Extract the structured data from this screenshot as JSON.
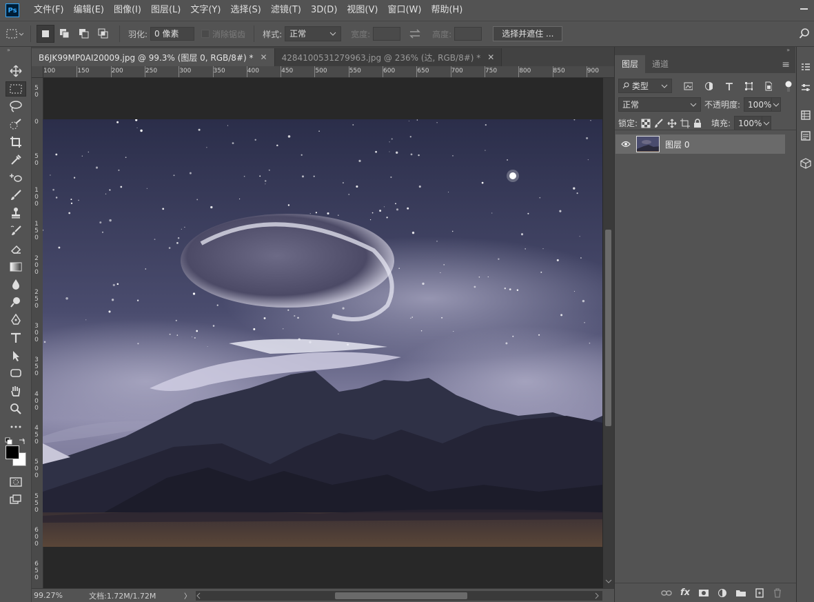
{
  "app": {
    "logo": "Ps"
  },
  "menu": [
    "文件(F)",
    "编辑(E)",
    "图像(I)",
    "图层(L)",
    "文字(Y)",
    "选择(S)",
    "滤镜(T)",
    "3D(D)",
    "视图(V)",
    "窗口(W)",
    "帮助(H)"
  ],
  "options": {
    "feather_label": "羽化:",
    "feather_value": "0 像素",
    "antialias_label": "消除锯齿",
    "style_label": "样式:",
    "style_value": "正常",
    "width_label": "宽度:",
    "height_label": "高度:",
    "select_mask_button": "选择并遮住 ..."
  },
  "tabs": [
    {
      "label": "B6JK99MP0AI20009.jpg @ 99.3% (图层 0, RGB/8#) *",
      "active": true
    },
    {
      "label": "4284100531279963.jpg @ 236% (达, RGB/8#) *",
      "active": false
    }
  ],
  "ruler": {
    "top": [
      "100",
      "150",
      "200",
      "250",
      "300",
      "350",
      "400",
      "450",
      "500",
      "550",
      "600",
      "650",
      "700",
      "750",
      "800",
      "850",
      "900"
    ],
    "left": [
      "5\n0",
      "0",
      "5\n0",
      "1\n0\n0",
      "1\n5\n0",
      "2\n0\n0",
      "2\n5\n0",
      "3\n0\n0",
      "3\n5\n0",
      "4\n0\n0",
      "4\n5\n0",
      "5\n0\n0",
      "5\n5\n0",
      "6\n0\n0",
      "6\n5\n0"
    ]
  },
  "status": {
    "zoom": "99.27%",
    "doc": "文档:1.72M/1.72M",
    "arrow": "〉"
  },
  "panel": {
    "tabs": [
      "图层",
      "通道"
    ],
    "kind_label": "类型",
    "blend_mode": "正常",
    "opacity_label": "不透明度:",
    "opacity_value": "100%",
    "lock_label": "锁定:",
    "fill_label": "填充:",
    "fill_value": "100%",
    "layer_name": "图层 0"
  },
  "icons": {
    "move": "move-icon",
    "marquee": "rect-marquee-icon",
    "lasso": "lasso-icon",
    "quick_select": "quick-select-icon",
    "crop": "crop-icon",
    "eyedropper": "eyedropper-icon",
    "healing": "healing-brush-icon",
    "brush": "brush-icon",
    "stamp": "clone-stamp-icon",
    "history_brush": "history-brush-icon",
    "eraser": "eraser-icon",
    "gradient": "gradient-icon",
    "blur": "blur-icon",
    "dodge": "dodge-icon",
    "pen": "pen-icon",
    "type": "type-icon",
    "path_select": "path-selection-icon",
    "shape": "rectangle-shape-icon",
    "hand": "hand-icon",
    "zoom": "zoom-icon",
    "more": "more-tools-icon"
  },
  "colors": {
    "fg": "#000000",
    "bg": "#ffffff",
    "accent": "#31a8ff"
  }
}
